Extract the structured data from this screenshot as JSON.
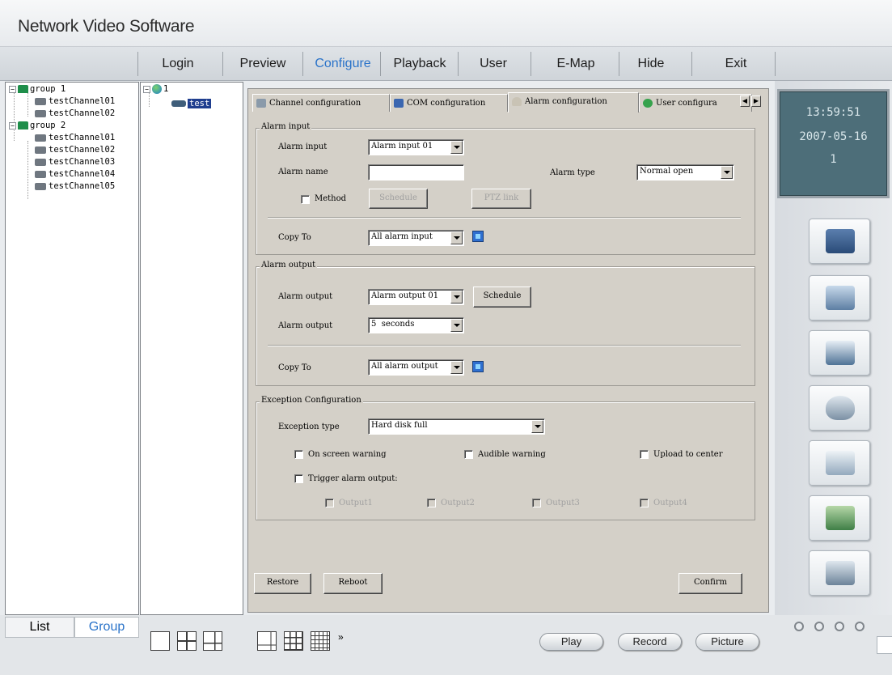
{
  "app": {
    "title": "Network Video Software"
  },
  "menu": {
    "items": [
      "Login",
      "Preview",
      "Configure",
      "Playback",
      "User",
      "E-Map",
      "Hide",
      "Exit"
    ],
    "active": "Configure",
    "active_color": "#2a73c9"
  },
  "group_tree": {
    "groups": [
      {
        "label": "group 1",
        "channels": [
          "testChannel01",
          "testChannel02"
        ]
      },
      {
        "label": "group 2",
        "channels": [
          "testChannel01",
          "testChannel02",
          "testChannel03",
          "testChannel04",
          "testChannel05"
        ]
      }
    ]
  },
  "device_tree": {
    "root": "1",
    "device": "test"
  },
  "tabs": [
    "Channel configuration",
    "COM configuration",
    "Alarm configuration",
    "User configura"
  ],
  "active_tab": "Alarm configuration",
  "alarm_input": {
    "title": "Alarm input",
    "input_label": "Alarm input",
    "input_value": "Alarm input 01",
    "name_label": "Alarm name",
    "name_value": "",
    "type_label": "Alarm type",
    "type_value": "Normal open",
    "method_label": "Method",
    "schedule_btn": "Schedule",
    "ptz_btn": "PTZ link",
    "copy_label": "Copy To",
    "copy_value": "All alarm input"
  },
  "alarm_output": {
    "title": "Alarm output",
    "output_label": "Alarm output",
    "output_value": "Alarm output 01",
    "schedule_btn": "Schedule",
    "duration_label": "Alarm output",
    "duration_value": "5  seconds",
    "copy_label": "Copy To",
    "copy_value": "All alarm output"
  },
  "exception": {
    "title": "Exception Configuration",
    "type_label": "Exception type",
    "type_value": "Hard disk full",
    "on_screen": "On screen warning",
    "audible": "Audible warning",
    "upload": "Upload to center",
    "trigger": "Trigger alarm output:",
    "outputs": [
      "Output1",
      "Output2",
      "Output3",
      "Output4"
    ]
  },
  "buttons": {
    "restore": "Restore",
    "reboot": "Reboot",
    "confirm": "Confirm"
  },
  "clock": {
    "time": "13:59:51",
    "date": "2007-05-16",
    "extra": "1"
  },
  "bottom": {
    "list_tab": "List",
    "group_tab": "Group",
    "more": "»",
    "play": "Play",
    "record": "Record",
    "picture": "Picture"
  }
}
